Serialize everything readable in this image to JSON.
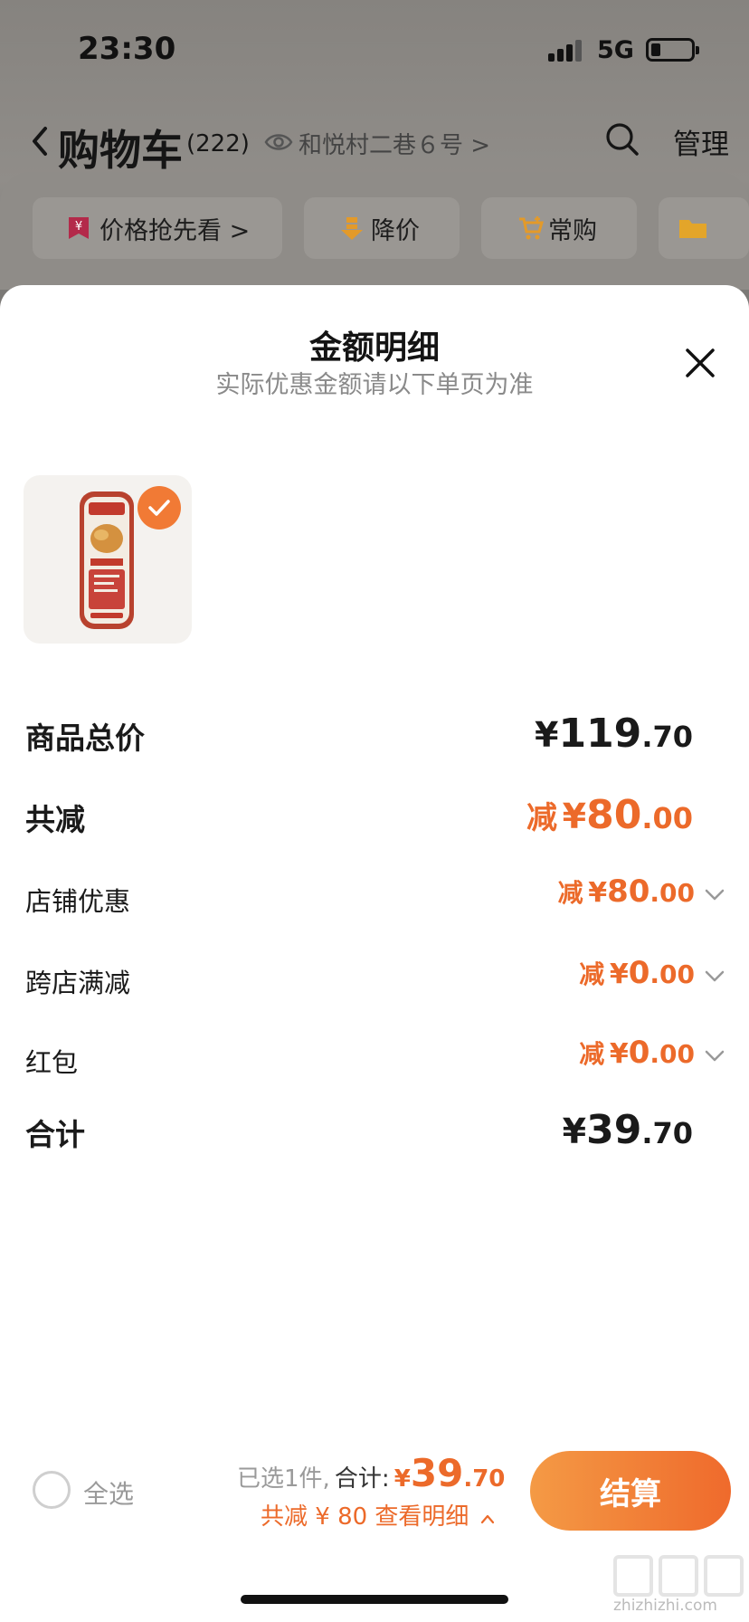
{
  "status_bar": {
    "time": "23:30",
    "network": "5G"
  },
  "nav": {
    "title": "购物车",
    "count": "(222)",
    "address": "和悦村二巷６号 >",
    "manage": "管理"
  },
  "chips": [
    {
      "label": "价格抢先看 >",
      "icon": "price-tag-icon"
    },
    {
      "label": "降价",
      "icon": "price-drop-icon"
    },
    {
      "label": "常购",
      "icon": "cart-plus-icon"
    },
    {
      "label": "",
      "icon": "folder-icon"
    }
  ],
  "sheet": {
    "title": "金额明细",
    "subtitle": "实际优惠金额请以下单页为准",
    "product": {
      "selected": true
    }
  },
  "rows": {
    "total_price": {
      "label": "商品总价",
      "yen": "¥",
      "int": "119",
      "dec": ".70"
    },
    "total_discount": {
      "label": "共减",
      "prefix": "减",
      "yen": "¥",
      "int": "80",
      "dec": ".00"
    },
    "shop_discount": {
      "label": "店铺优惠",
      "prefix": "减",
      "yen": "¥",
      "int": "80",
      "dec": ".00"
    },
    "cross_shop": {
      "label": "跨店满减",
      "prefix": "减",
      "yen": "¥",
      "int": "0",
      "dec": ".00"
    },
    "red_packet": {
      "label": "红包",
      "prefix": "减",
      "yen": "¥",
      "int": "0",
      "dec": ".00"
    },
    "grand_total": {
      "label": "合计",
      "yen": "¥",
      "int": "39",
      "dec": ".70"
    }
  },
  "bottom": {
    "select_all": "全选",
    "selected_text": "已选1件,",
    "total_label": "合计:",
    "yen": "¥",
    "int": "39",
    "dec": ".70",
    "saved_text": "共减 ¥ 80  查看明细",
    "checkout": "结算"
  },
  "watermark": {
    "site": "zhizhizhi.com"
  },
  "colors": {
    "accent": "#ec6a2a",
    "button_start": "#f49a45",
    "button_end": "#ef6a2c"
  }
}
